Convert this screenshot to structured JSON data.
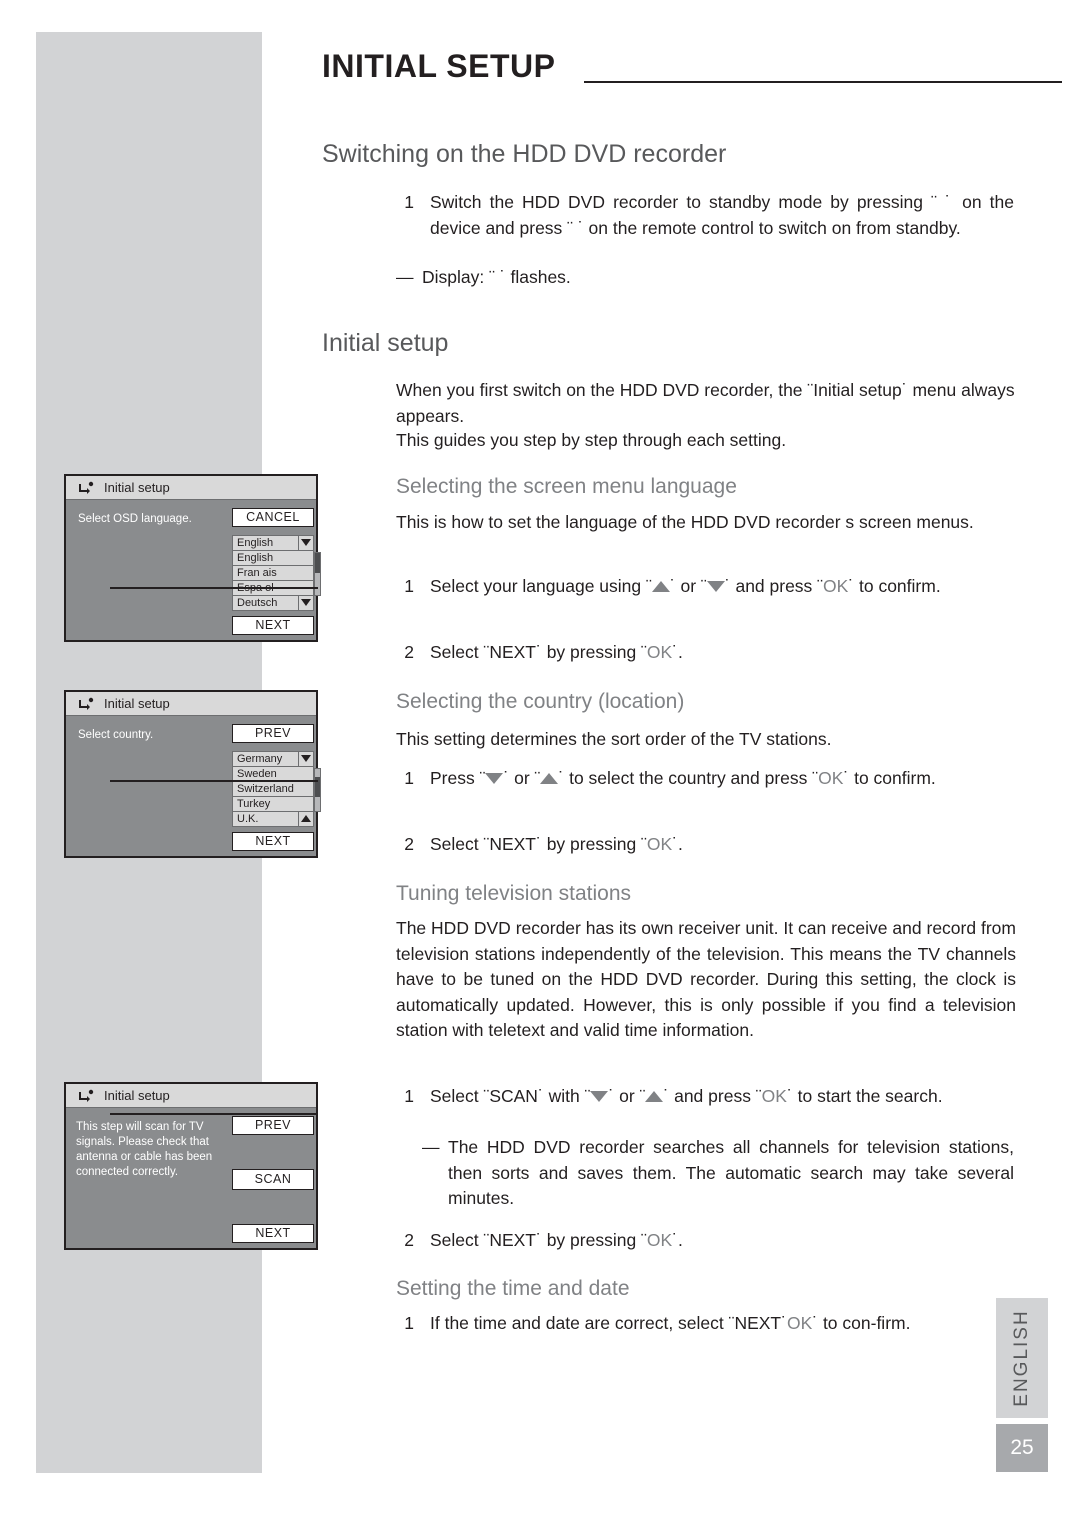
{
  "header": {
    "title": "INITIAL SETUP"
  },
  "sections": {
    "switching": {
      "heading": "Switching on the HDD DVD recorder",
      "step1_num": "1",
      "step1_text": "Switch the HDD DVD recorder to standby mode by pressing ¨    ˙ on the device and press ¨  ˙ on the remote control to switch on from standby.",
      "dash1_mark": "—",
      "dash1_text": "Display: ¨             ˙ flashes."
    },
    "initial_setup": {
      "heading": "Initial setup",
      "para1": "When you first switch on the HDD DVD recorder, the ¨Initial setup˙ menu always appears.",
      "para2": "This guides you step by step through each setting."
    },
    "screen_language": {
      "heading": "Selecting the screen menu language",
      "para1": "This is how to set the language of the HDD DVD recorder s screen menus.",
      "step1_num": "1",
      "step1_text_a": "Select your language using ¨",
      "step1_text_b": "˙ or ¨",
      "step1_text_c": "˙ and press ¨",
      "step1_ok": "OK",
      "step1_text_d": "˙ to confirm.",
      "step2_num": "2",
      "step2_text_a": "Select ¨NEXT˙ by pressing ¨",
      "step2_ok": "OK",
      "step2_text_b": "˙."
    },
    "country": {
      "heading": "Selecting the country (location)",
      "para1": "This setting determines the sort order of the TV stations.",
      "step1_num": "1",
      "step1_text_a": "Press ¨",
      "step1_text_b": "˙ or ¨",
      "step1_text_c": "˙ to select the country and press ¨",
      "step1_ok": "OK",
      "step1_text_d": "˙ to confirm.",
      "step2_num": "2",
      "step2_text_a": "Select ¨NEXT˙ by pressing ¨",
      "step2_ok": "OK",
      "step2_text_b": "˙."
    },
    "tuning": {
      "heading": "Tuning television stations",
      "para1": "The HDD DVD recorder has its own receiver unit. It can receive and record from television stations independently of the television. This means the TV channels have to be tuned on the HDD DVD recorder. During this setting, the clock is automatically updated. However, this is only possible if you find a television station with teletext and valid time information.",
      "step1_num": "1",
      "step1_text_a": "Select ¨SCAN˙ with ¨",
      "step1_text_b": "˙ or ¨",
      "step1_text_c": "˙ and press ¨",
      "step1_ok": "OK",
      "step1_text_d": "˙ to start the search.",
      "dash1_mark": "—",
      "dash1_text": "The HDD DVD recorder searches all channels for television stations, then sorts and saves them. The automatic search may take several minutes.",
      "step2_num": "2",
      "step2_text_a": "Select ¨NEXT˙ by pressing ¨",
      "step2_ok": "OK",
      "step2_text_b": "˙."
    },
    "time_date": {
      "heading": "Setting the time and date",
      "step1_num": "1",
      "step1_text_a": "If the time and date are correct, select ¨NEXT˙",
      "step1_ok": "OK",
      "step1_text_b": "˙ to con-firm."
    }
  },
  "osd_language": {
    "title": "Initial setup",
    "label": "Select OSD language.",
    "cancel": "CANCEL",
    "next": "NEXT",
    "rows": [
      {
        "text": "English",
        "selected": false,
        "arrow": "dn"
      },
      {
        "text": "English",
        "selected": false,
        "arrow": ""
      },
      {
        "text": "Fran ais",
        "selected": false,
        "arrow": ""
      },
      {
        "text": "Espa ol",
        "selected": false,
        "arrow": ""
      },
      {
        "text": "Deutsch",
        "selected": false,
        "arrow": "dn"
      }
    ]
  },
  "osd_country": {
    "title": "Initial setup",
    "label": "Select country.",
    "prev": "PREV",
    "next": "NEXT",
    "rows": [
      {
        "text": "Germany",
        "selected": false,
        "arrow": "dn"
      },
      {
        "text": "Sweden",
        "selected": false,
        "arrow": ""
      },
      {
        "text": "Switzerland",
        "selected": false,
        "arrow": ""
      },
      {
        "text": "Turkey",
        "selected": false,
        "arrow": ""
      },
      {
        "text": "U.K.",
        "selected": false,
        "arrow": "up"
      }
    ]
  },
  "osd_scan": {
    "title": "Initial setup",
    "label": "This step will scan for TV signals. Please check that antenna or cable has been connected correctly.",
    "prev": "PREV",
    "scan": "SCAN",
    "next": "NEXT"
  },
  "sidebar": {
    "language_tab": "ENGLISH",
    "page_number": "25"
  }
}
